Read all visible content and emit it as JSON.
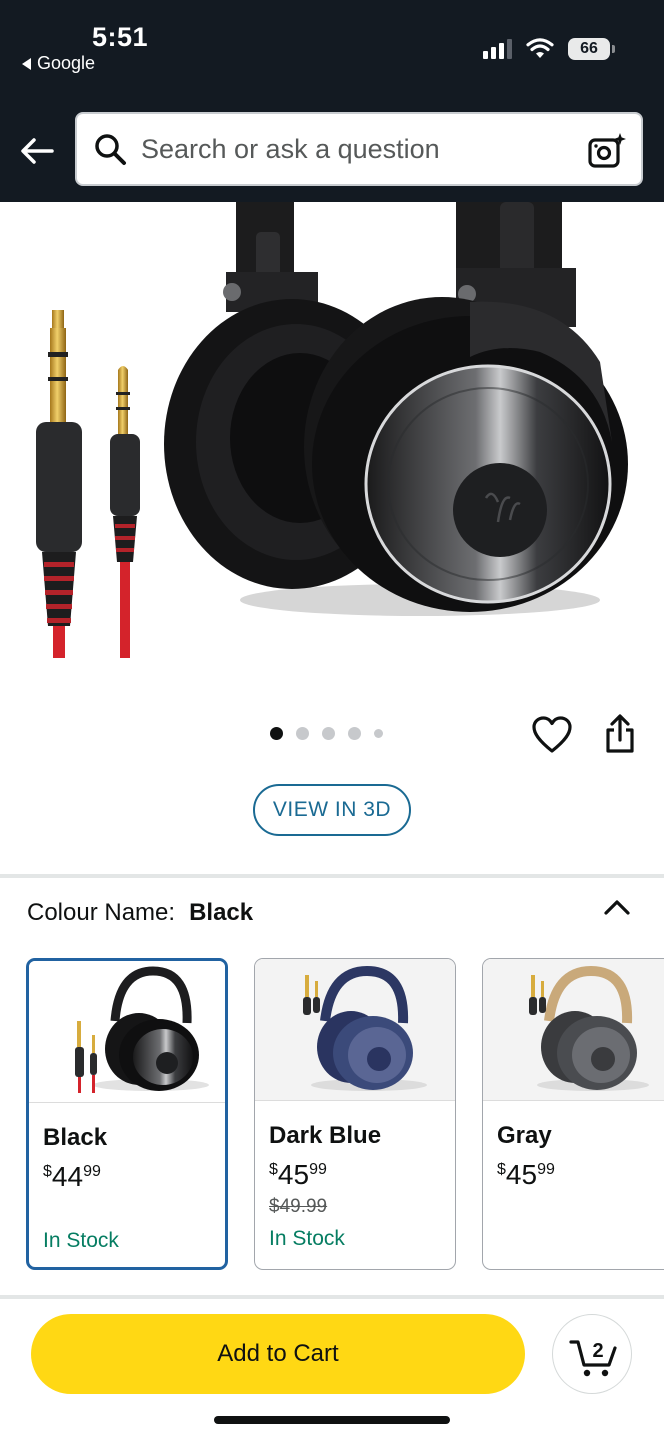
{
  "status_bar": {
    "time": "5:51",
    "back_app": "Google",
    "battery": "66"
  },
  "search": {
    "placeholder": "Search or ask a question"
  },
  "icons": {
    "back": "back-arrow-icon",
    "search": "search-icon",
    "camera": "camera-scan-icon",
    "wishlist": "heart-icon",
    "share": "share-icon",
    "collapse": "chevron-up-icon",
    "cart": "cart-icon"
  },
  "carousel": {
    "image_count": 5,
    "active_index": 0
  },
  "view_3d": "VIEW IN 3D",
  "colour": {
    "label": "Colour Name:",
    "selected": "Black",
    "options": [
      {
        "name": "Black",
        "price_whole": "44",
        "price_cents": "99",
        "currency": "$",
        "list_price": "",
        "stock": "In Stock",
        "selected": true
      },
      {
        "name": "Dark Blue",
        "price_whole": "45",
        "price_cents": "99",
        "currency": "$",
        "list_price": "$49.99",
        "stock": "In Stock",
        "selected": false
      },
      {
        "name": "Gray",
        "price_whole": "45",
        "price_cents": "99",
        "currency": "$",
        "list_price": "",
        "stock": "",
        "selected": false
      }
    ]
  },
  "add_to_cart": "Add to Cart",
  "cart_count": "2",
  "colors": {
    "header_bg": "#131a22",
    "accent_blue": "#2162a1",
    "cart_yellow": "#ffd814",
    "stock_green": "#067d62",
    "variant_blue": "#3b4a7a",
    "variant_gold": "#c9a97a"
  }
}
